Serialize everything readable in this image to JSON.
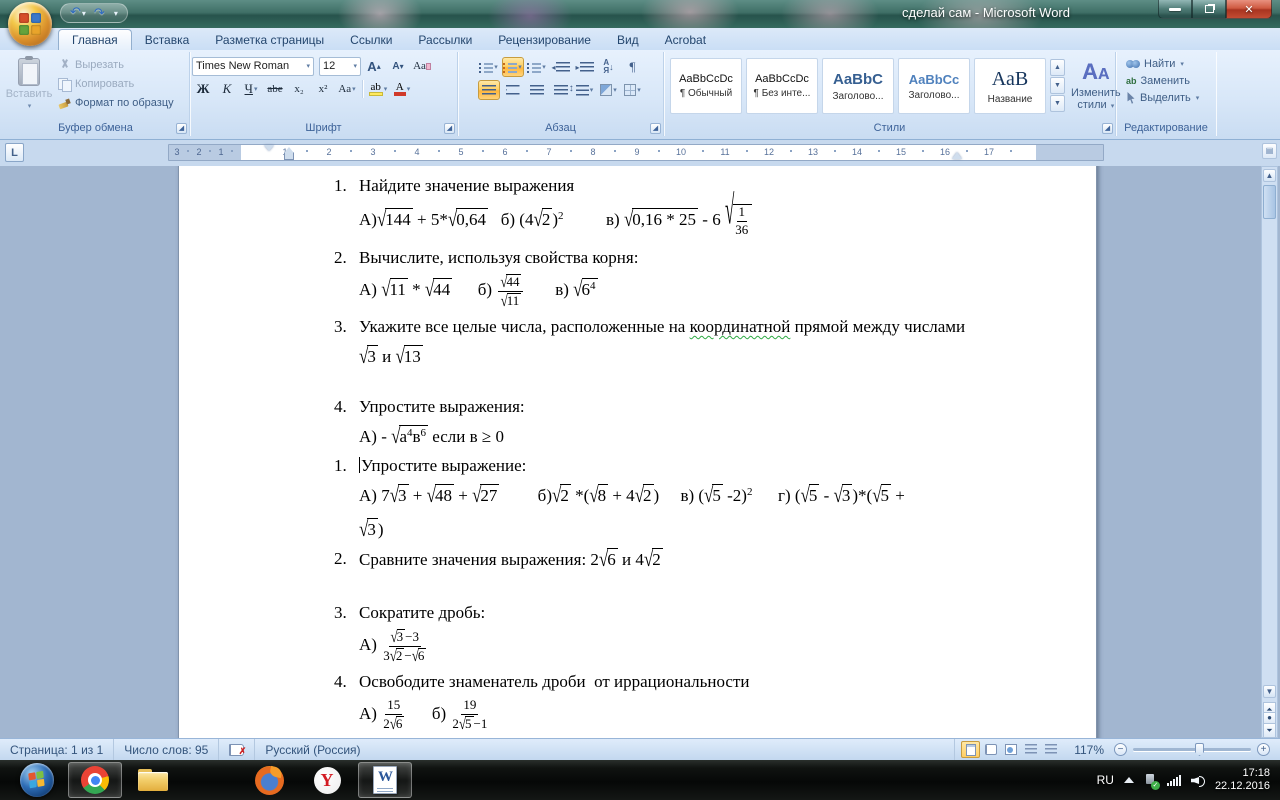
{
  "window": {
    "title": "сделай сам - Microsoft Word"
  },
  "tabs": [
    {
      "label": "Главная",
      "active": true
    },
    {
      "label": "Вставка"
    },
    {
      "label": "Разметка страницы"
    },
    {
      "label": "Ссылки"
    },
    {
      "label": "Рассылки"
    },
    {
      "label": "Рецензирование"
    },
    {
      "label": "Вид"
    },
    {
      "label": "Acrobat"
    }
  ],
  "ribbon": {
    "clipboard": {
      "group_label": "Буфер обмена",
      "paste": "Вставить",
      "cut": "Вырезать",
      "copy": "Копировать",
      "format_painter": "Формат по образцу"
    },
    "font": {
      "group_label": "Шрифт",
      "font_name": "Times New Roman",
      "font_size": "12",
      "bold": "Ж",
      "italic": "К",
      "underline": "Ч",
      "strike": "abe",
      "subscript": "x₂",
      "superscript": "x²",
      "change_case": "Aa",
      "highlight": "ab",
      "font_color": "А",
      "clear_format": "Аа"
    },
    "paragraph": {
      "group_label": "Абзац",
      "sort_top": "А",
      "sort_bottom": "Я",
      "pilcrow": "¶"
    },
    "styles": {
      "group_label": "Стили",
      "change_styles_line1": "Изменить",
      "change_styles_line2": "стили",
      "aa": "A",
      "items": [
        {
          "preview": "AaBbCcDc",
          "name": "¶ Обычный",
          "kind": "normal"
        },
        {
          "preview": "AaBbCcDc",
          "name": "¶ Без инте...",
          "kind": "normal"
        },
        {
          "preview": "AaBbC",
          "name": "Заголово...",
          "kind": "h1"
        },
        {
          "preview": "AaBbCc",
          "name": "Заголово...",
          "kind": "h2"
        },
        {
          "preview": "АаВ",
          "name": "Название",
          "kind": "title"
        }
      ]
    },
    "editing": {
      "group_label": "Редактирование",
      "find": "Найти",
      "replace": "Заменить",
      "select": "Выделить"
    }
  },
  "ruler": {
    "margin_numbers": [
      {
        "v": "3",
        "x": 2
      },
      {
        "v": "2",
        "x": 24
      },
      {
        "v": "1",
        "x": 46
      }
    ],
    "numbers": [
      "1",
      "2",
      "3",
      "4",
      "5",
      "6",
      "7",
      "8",
      "9",
      "10",
      "11",
      "12",
      "13",
      "14",
      "15",
      "16",
      "17"
    ]
  },
  "document": {
    "paragraphs": [
      {
        "marker": "1.",
        "cls": "m6",
        "runs": [
          {
            "t": "x",
            "v": "Найдите значение выражения"
          }
        ]
      },
      {
        "cls": "fx m2",
        "runs": [
          {
            "t": "x",
            "v": "А)"
          },
          {
            "t": "s",
            "r": [
              {
                "t": "x",
                "v": "144"
              }
            ]
          },
          {
            "t": "x",
            "v": " + 5*"
          },
          {
            "t": "s",
            "r": [
              {
                "t": "x",
                "v": "0,64"
              }
            ]
          },
          {
            "t": "x",
            "v": "   б) (4"
          },
          {
            "t": "s",
            "r": [
              {
                "t": "x",
                "v": "2"
              }
            ]
          },
          {
            "t": "x",
            "v": ")"
          },
          {
            "t": "p",
            "v": "2"
          },
          {
            "t": "x",
            "v": "          в) "
          },
          {
            "t": "s",
            "r": [
              {
                "t": "x",
                "v": "0,16 * 25"
              }
            ]
          },
          {
            "t": "x",
            "v": " - 6 "
          },
          {
            "t": "s",
            "r": [
              {
                "t": "f",
                "n": [
                  {
                    "t": "x",
                    "v": "1"
                  }
                ],
                "d": [
                  {
                    "t": "x",
                    "v": "36"
                  }
                ]
              }
            ]
          }
        ]
      },
      {
        "marker": "2.",
        "cls": "m4",
        "runs": [
          {
            "t": "x",
            "v": "Вычислите, используя свойства корня:"
          }
        ]
      },
      {
        "cls": "fx",
        "runs": [
          {
            "t": "x",
            "v": "А) "
          },
          {
            "t": "s",
            "r": [
              {
                "t": "x",
                "v": "11"
              }
            ]
          },
          {
            "t": "x",
            "v": " * "
          },
          {
            "t": "s",
            "r": [
              {
                "t": "x",
                "v": "44"
              }
            ]
          },
          {
            "t": "x",
            "v": "      б) "
          },
          {
            "t": "f",
            "n": [
              {
                "t": "s",
                "r": [
                  {
                    "t": "x",
                    "v": "44"
                  }
                ]
              }
            ],
            "d": [
              {
                "t": "s",
                "r": [
                  {
                    "t": "x",
                    "v": "11"
                  }
                ]
              }
            ]
          },
          {
            "t": "x",
            "v": "       в) "
          },
          {
            "t": "s",
            "r": [
              {
                "t": "x",
                "v": "6"
              },
              {
                "t": "p",
                "v": "4"
              }
            ]
          }
        ]
      },
      {
        "marker": "3.",
        "cls": "m2",
        "runs": [
          {
            "t": "x",
            "v": "Укажите все целые числа, расположенные на "
          },
          {
            "t": "m",
            "v": "координатной"
          },
          {
            "t": "x",
            "v": " прямой между числами"
          }
        ]
      },
      {
        "cls": "fx m2",
        "runs": [
          {
            "t": "s",
            "r": [
              {
                "t": "x",
                "v": "3"
              }
            ]
          },
          {
            "t": "x",
            "v": " и "
          },
          {
            "t": "s",
            "r": [
              {
                "t": "x",
                "v": "13"
              }
            ]
          }
        ]
      },
      {
        "blank": true
      },
      {
        "marker": "4.",
        "runs": [
          {
            "t": "x",
            "v": "Упростите выражения:"
          }
        ]
      },
      {
        "cls": "fx m2",
        "runs": [
          {
            "t": "x",
            "v": "А) - "
          },
          {
            "t": "s",
            "r": [
              {
                "t": "x",
                "v": "а"
              },
              {
                "t": "p",
                "v": "4"
              },
              {
                "t": "x",
                "v": "в"
              },
              {
                "t": "p",
                "v": "6"
              }
            ]
          },
          {
            "t": "x",
            "v": " если в ≥ 0"
          }
        ]
      },
      {
        "marker": "1.",
        "cls": "m2",
        "runs": [
          {
            "t": "c"
          },
          {
            "t": "x",
            "v": "Упростите выражение:"
          }
        ]
      },
      {
        "cls": "fx m2",
        "runs": [
          {
            "t": "x",
            "v": "А) 7"
          },
          {
            "t": "s",
            "r": [
              {
                "t": "x",
                "v": "3"
              }
            ]
          },
          {
            "t": "x",
            "v": " + "
          },
          {
            "t": "s",
            "r": [
              {
                "t": "x",
                "v": "48"
              }
            ]
          },
          {
            "t": "x",
            "v": " + "
          },
          {
            "t": "s",
            "r": [
              {
                "t": "x",
                "v": "27"
              }
            ]
          },
          {
            "t": "x",
            "v": "         б)"
          },
          {
            "t": "s",
            "r": [
              {
                "t": "x",
                "v": "2"
              }
            ]
          },
          {
            "t": "x",
            "v": " *("
          },
          {
            "t": "s",
            "r": [
              {
                "t": "x",
                "v": "8"
              }
            ]
          },
          {
            "t": "x",
            "v": " + 4"
          },
          {
            "t": "s",
            "r": [
              {
                "t": "x",
                "v": "2"
              }
            ]
          },
          {
            "t": "x",
            "v": ")     в) ("
          },
          {
            "t": "s",
            "r": [
              {
                "t": "x",
                "v": "5"
              }
            ]
          },
          {
            "t": "x",
            "v": " -2)"
          },
          {
            "t": "p",
            "v": "2"
          },
          {
            "t": "x",
            "v": "      г) ("
          },
          {
            "t": "s",
            "r": [
              {
                "t": "x",
                "v": "5"
              }
            ]
          },
          {
            "t": "x",
            "v": " - "
          },
          {
            "t": "s",
            "r": [
              {
                "t": "x",
                "v": "3"
              }
            ]
          },
          {
            "t": "x",
            "v": ")*("
          },
          {
            "t": "s",
            "r": [
              {
                "t": "x",
                "v": "5"
              }
            ]
          },
          {
            "t": "x",
            "v": " +"
          }
        ]
      },
      {
        "cls": "fx",
        "runs": [
          {
            "t": "s",
            "r": [
              {
                "t": "x",
                "v": "3"
              }
            ]
          },
          {
            "t": "x",
            "v": ")"
          }
        ]
      },
      {
        "marker": "2.",
        "cls": "m2",
        "runs": [
          {
            "t": "x",
            "v": "Сравните значения выражения: 2"
          },
          {
            "t": "s",
            "r": [
              {
                "t": "x",
                "v": "6"
              }
            ]
          },
          {
            "t": "x",
            "v": " и 4"
          },
          {
            "t": "s",
            "r": [
              {
                "t": "x",
                "v": "2"
              }
            ]
          }
        ]
      },
      {
        "blank": true
      },
      {
        "marker": "3.",
        "cls": "m8",
        "runs": [
          {
            "t": "x",
            "v": "Сократите дробь:"
          }
        ]
      },
      {
        "cls": "fx",
        "runs": [
          {
            "t": "x",
            "v": "А) "
          },
          {
            "t": "f",
            "n": [
              {
                "t": "s",
                "r": [
                  {
                    "t": "x",
                    "v": "3"
                  }
                ]
              },
              {
                "t": "x",
                "v": "−3"
              }
            ],
            "d": [
              {
                "t": "x",
                "v": "3"
              },
              {
                "t": "s",
                "r": [
                  {
                    "t": "x",
                    "v": "2"
                  }
                ]
              },
              {
                "t": "x",
                "v": "−"
              },
              {
                "t": "s",
                "r": [
                  {
                    "t": "x",
                    "v": "6"
                  }
                ]
              }
            ]
          }
        ]
      },
      {
        "marker": "4.",
        "cls": "m2",
        "runs": [
          {
            "t": "x",
            "v": "Освободите знаменатель дроби  от иррациональности"
          }
        ]
      },
      {
        "cls": "fx",
        "runs": [
          {
            "t": "x",
            "v": "А) "
          },
          {
            "t": "f",
            "n": [
              {
                "t": "x",
                "v": "15"
              }
            ],
            "d": [
              {
                "t": "x",
                "v": "2"
              },
              {
                "t": "s",
                "r": [
                  {
                    "t": "x",
                    "v": "6"
                  }
                ]
              }
            ]
          },
          {
            "t": "x",
            "v": "      б) "
          },
          {
            "t": "f",
            "n": [
              {
                "t": "x",
                "v": "19"
              }
            ],
            "d": [
              {
                "t": "x",
                "v": "2"
              },
              {
                "t": "s",
                "r": [
                  {
                    "t": "x",
                    "v": "5"
                  }
                ]
              },
              {
                "t": "x",
                "v": "−1"
              }
            ]
          }
        ]
      }
    ]
  },
  "status_bar": {
    "page": "Страница: 1 из 1",
    "words": "Число слов: 95",
    "language": "Русский (Россия)",
    "zoom_level": "117%"
  },
  "taskbar": {
    "apps": [
      {
        "name": "start",
        "active": false
      },
      {
        "name": "chrome",
        "active": true
      },
      {
        "name": "explorer",
        "active": false
      },
      {
        "name": "media-player",
        "active": false
      },
      {
        "name": "firefox",
        "active": false
      },
      {
        "name": "yandex",
        "active": false
      },
      {
        "name": "word",
        "active": true
      }
    ],
    "tray": {
      "lang": "RU",
      "time": "17:18",
      "date": "22.12.2016"
    }
  }
}
